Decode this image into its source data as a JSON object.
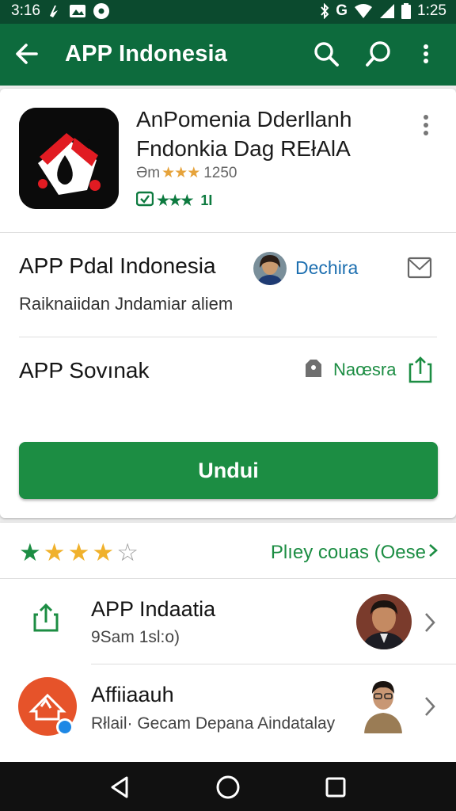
{
  "status_bar": {
    "time_left": "3:16",
    "time_right": "1:25",
    "network": "G",
    "icons": [
      "notification-icon",
      "image-icon",
      "circle-icon",
      "bluetooth-icon",
      "wifi-icon",
      "signal-icon",
      "battery-icon"
    ]
  },
  "app_bar": {
    "title": "APP Indonesia",
    "icons": [
      "back-arrow-icon",
      "search-icon",
      "chat-search-icon",
      "more-vert-icon"
    ]
  },
  "app": {
    "title_line1": "AnPomenia Dderllanh",
    "title_line2": "Fndonkia Dag REłAlA",
    "meta_prefix": "Əm",
    "meta_stars": "★★★",
    "meta_count": "1250",
    "badge_stars": "★★★",
    "badge_text": "1Ι",
    "icon": "app-logo-icon"
  },
  "developer": {
    "title": "APP Pdal Indonesia",
    "name": "Dechira",
    "description": "Raiknaiidan Jndamiar aliem"
  },
  "secondary": {
    "title": "APP Sovınak",
    "action_label": "Naœsra"
  },
  "install_button": {
    "label": "Undui"
  },
  "rating": {
    "filled": 4,
    "total": 5,
    "link_text": "Plıey couas (Oese"
  },
  "list": [
    {
      "title": "APP Indaatia",
      "subtitle": "9Sam 1sl:o)",
      "icon": "share-icon"
    },
    {
      "title": "Affiiaauh",
      "subtitle": "Rłlail· Gecam Depana Aindatalay",
      "icon": "app-badge-icon"
    }
  ],
  "colors": {
    "status_bar": "#0b4a2e",
    "app_bar": "#0d6b3d",
    "accent_green": "#1c8d43",
    "link_blue": "#1d6fb0",
    "star_gold": "#f0b12c"
  }
}
